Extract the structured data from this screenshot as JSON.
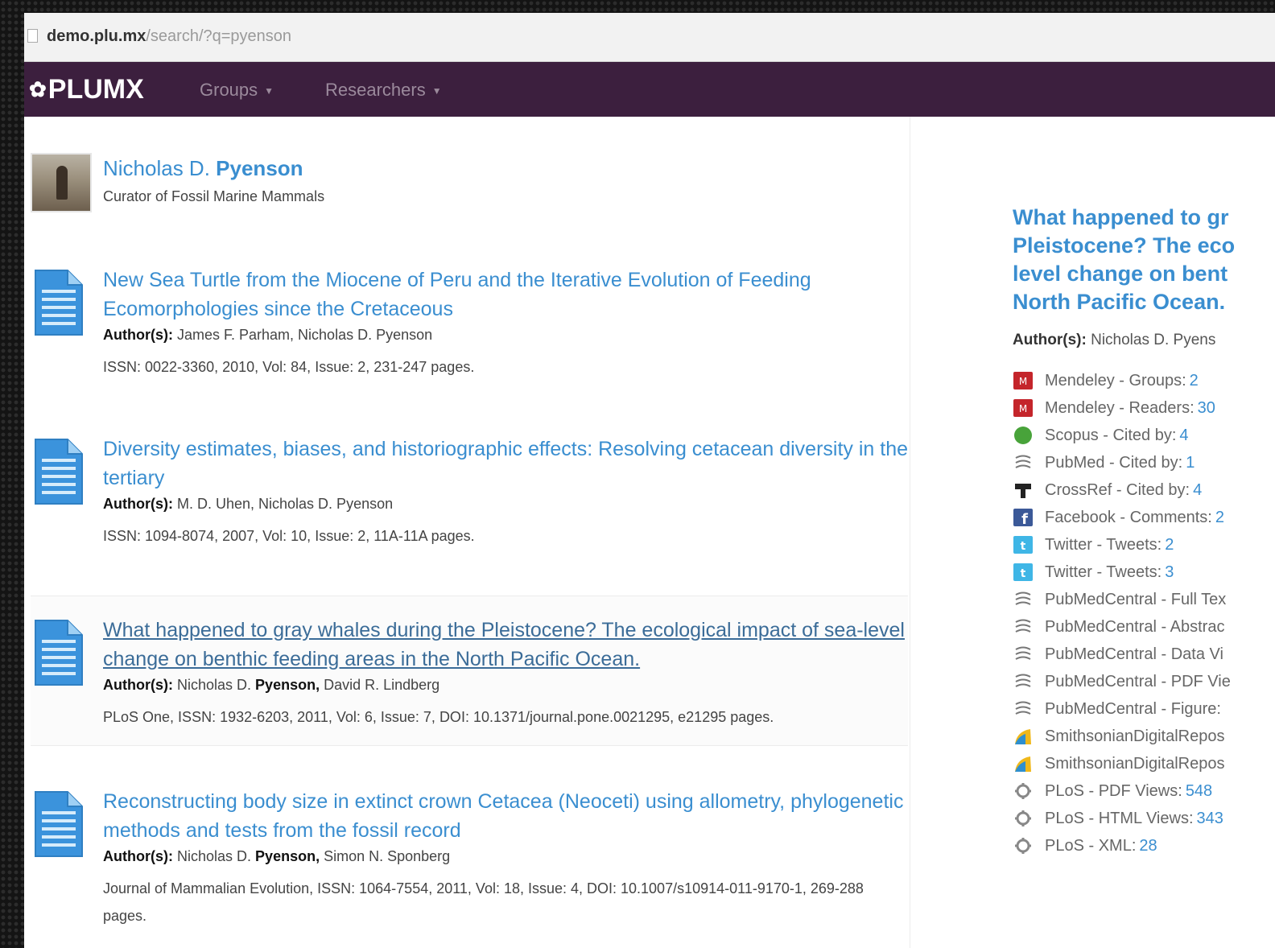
{
  "browser": {
    "url_host": "demo.plu.mx",
    "url_path": "/search/?q=pyenson"
  },
  "navbar": {
    "logo_text": "PLUMX",
    "logo_icon": "plumx-logo-icon",
    "items": [
      {
        "label": "Groups",
        "icon": "caret-down-icon"
      },
      {
        "label": "Researchers",
        "icon": "caret-down-icon"
      }
    ],
    "colors": {
      "bar": "#3c1f3e",
      "link": "#3a8ed0"
    }
  },
  "profile": {
    "first_name": "Nicholas D.",
    "last_name": "Pyenson",
    "title": "Curator of Fossil Marine Mammals"
  },
  "publications": [
    {
      "title": "New Sea Turtle from the Miocene of Peru and the Iterative Evolution of Feeding Ecomorphologies since the Cretaceous",
      "authors_label": "Author(s):",
      "authors_pre": "James F. Parham, Nicholas D. Pyenson",
      "authors_bold": "",
      "authors_post": "",
      "meta": "ISSN: 0022-3360, 2010, Vol: 84, Issue: 2, 231-247 pages."
    },
    {
      "title": "Diversity estimates, biases, and historiographic effects: Resolving cetacean diversity in the tertiary",
      "authors_label": "Author(s):",
      "authors_pre": "M. D. Uhen, Nicholas D. Pyenson",
      "authors_bold": "",
      "authors_post": "",
      "meta": "ISSN: 1094-8074, 2007, Vol: 10, Issue: 2, 11A-11A pages."
    },
    {
      "title": "What happened to gray whales during the Pleistocene? The ecological impact of sea-level change on benthic feeding areas in the North Pacific Ocean.",
      "authors_label": "Author(s):",
      "authors_pre": "Nicholas D.",
      "authors_bold": "Pyenson,",
      "authors_post": "David R. Lindberg",
      "meta": "PLoS One, ISSN: 1932-6203, 2011, Vol: 6, Issue: 7, DOI: 10.1371/journal.pone.0021295, e21295 pages."
    },
    {
      "title": "Reconstructing body size in extinct crown Cetacea (Neoceti) using allometry, phylogenetic methods and tests from the fossil record",
      "authors_label": "Author(s):",
      "authors_pre": "Nicholas D.",
      "authors_bold": "Pyenson,",
      "authors_post": "Simon N. Sponberg",
      "meta": "Journal of Mammalian Evolution, ISSN: 1064-7554, 2011, Vol: 18, Issue: 4, DOI: 10.1007/s10914-011-9170-1, 269-288 pages."
    }
  ],
  "detail": {
    "title_lines": [
      "What happened to gr",
      "Pleistocene? The eco",
      "level change on bent",
      "North Pacific Ocean."
    ],
    "authors_label": "Author(s):",
    "authors": "Nicholas D. Pyens",
    "metrics": [
      {
        "icon": "mendeley-icon",
        "label": "Mendeley - Groups:",
        "value": "2"
      },
      {
        "icon": "mendeley-icon",
        "label": "Mendeley - Readers:",
        "value": "30"
      },
      {
        "icon": "scopus-icon",
        "label": "Scopus - Cited by:",
        "value": "4"
      },
      {
        "icon": "pubmed-icon",
        "label": "PubMed - Cited by:",
        "value": "1"
      },
      {
        "icon": "crossref-icon",
        "label": "CrossRef - Cited by:",
        "value": "4"
      },
      {
        "icon": "facebook-icon",
        "label": "Facebook - Comments:",
        "value": "2"
      },
      {
        "icon": "twitter-icon",
        "label": "Twitter - Tweets:",
        "value": "2"
      },
      {
        "icon": "twitter-icon",
        "label": "Twitter - Tweets:",
        "value": "3"
      },
      {
        "icon": "pubmed-icon",
        "label": "PubMedCentral - Full Tex",
        "value": ""
      },
      {
        "icon": "pubmed-icon",
        "label": "PubMedCentral - Abstrac",
        "value": ""
      },
      {
        "icon": "pubmed-icon",
        "label": "PubMedCentral - Data Vi",
        "value": ""
      },
      {
        "icon": "pubmed-icon",
        "label": "PubMedCentral - PDF Vie",
        "value": ""
      },
      {
        "icon": "pubmed-icon",
        "label": "PubMedCentral - Figure:",
        "value": ""
      },
      {
        "icon": "repository-icon",
        "label": "SmithsonianDigitalRepos",
        "value": ""
      },
      {
        "icon": "repository-icon",
        "label": "SmithsonianDigitalRepos",
        "value": ""
      },
      {
        "icon": "plos-icon",
        "label": "PLoS - PDF Views:",
        "value": "548"
      },
      {
        "icon": "plos-icon",
        "label": "PLoS - HTML Views:",
        "value": "343"
      },
      {
        "icon": "plos-icon",
        "label": "PLoS - XML:",
        "value": "28"
      }
    ]
  }
}
